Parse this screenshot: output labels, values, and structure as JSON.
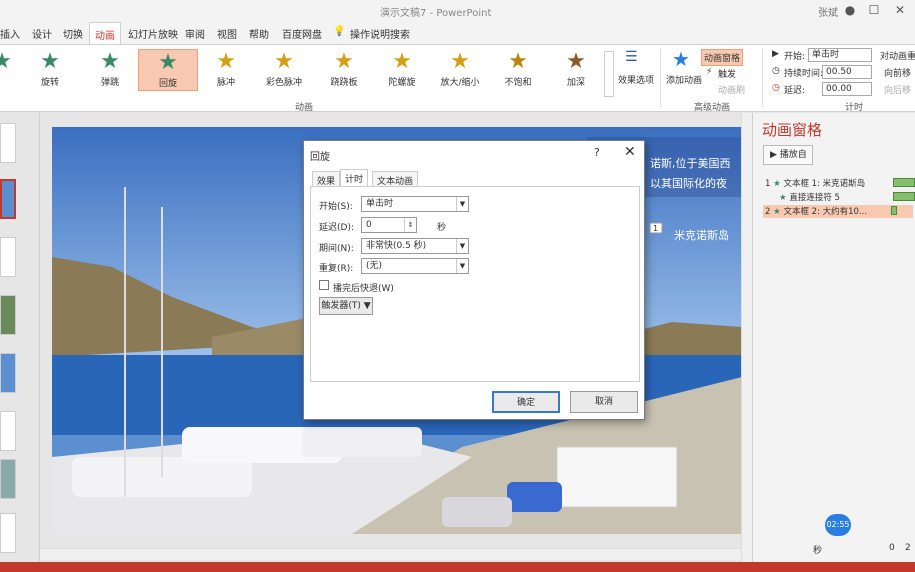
{
  "window": {
    "title": "演示文稿7 - PowerPoint",
    "user": "张斌",
    "help_glyph": "?",
    "minimize_glyph": "—",
    "restore_glyph": "☐",
    "close_glyph": "✕"
  },
  "tabs": [
    "插入",
    "设计",
    "切换",
    "动画",
    "幻灯片放映",
    "审阅",
    "视图",
    "帮助",
    "百度网盘",
    "操作说明搜索"
  ],
  "active_tab": "动画",
  "ribbon": {
    "animations": [
      {
        "label": "旋转",
        "color": "#3a8a6a"
      },
      {
        "label": "弹跳",
        "color": "#3a8a6a"
      },
      {
        "label": "回旋",
        "color": "#3a8a6a"
      },
      {
        "label": "脉冲",
        "color": "#d4a017"
      },
      {
        "label": "彩色脉冲",
        "color": "#d4a017"
      },
      {
        "label": "跷跷板",
        "color": "#d4a017"
      },
      {
        "label": "陀螺旋",
        "color": "#d4a017"
      },
      {
        "label": "放大/缩小",
        "color": "#d4a017"
      },
      {
        "label": "不饱和",
        "color": "#b8860b"
      },
      {
        "label": "加深",
        "color": "#8b5a2b"
      }
    ],
    "selected_animation": "回旋",
    "effect_options": "效果选项",
    "group_animation": "动画",
    "add_animation": "添加动画",
    "anim_pane_btn": "动画窗格",
    "trigger": "触发",
    "anim_painter": "动画刷",
    "group_advanced": "高级动画",
    "start_label": "开始:",
    "start_value": "单击时",
    "duration_label": "持续时间:",
    "duration_value": "00.50",
    "delay_label": "延迟:",
    "delay_value": "00.00",
    "reorder": "对动画重",
    "move_earlier": "向前移",
    "move_later": "向后移",
    "group_timing": "计时"
  },
  "slide": {
    "text_line1": "诺斯,位于美国西",
    "text_line2": "以其国际化的夜",
    "badge": "1",
    "caption": "米克诺斯岛"
  },
  "dialog": {
    "title": "回旋",
    "tabs": [
      "效果",
      "计时",
      "文本动画"
    ],
    "active_tab": "计时",
    "start_label": "开始(S):",
    "start_value": "单击时",
    "delay_label": "延迟(D):",
    "delay_value": "0",
    "delay_unit": "秒",
    "period_label": "期间(N):",
    "period_value": "非常快(0.5 秒)",
    "repeat_label": "重复(R):",
    "repeat_value": "(无)",
    "rewind_label": "播完后快退(W)",
    "trigger_btn": "触发器(T)",
    "ok": "确定",
    "cancel": "取消"
  },
  "pane": {
    "title": "动画窗格",
    "play": "播放自",
    "items": [
      {
        "num": "1",
        "text": "文本框 1: 米克诺斯岛"
      },
      {
        "num": "",
        "text": "直接连接符 5"
      },
      {
        "num": "2",
        "text": "文本框 2: 大约有10..."
      }
    ],
    "seconds": "秒",
    "time_badge": "02:55",
    "page_fragment": "0",
    "page_fragment2": "2"
  }
}
